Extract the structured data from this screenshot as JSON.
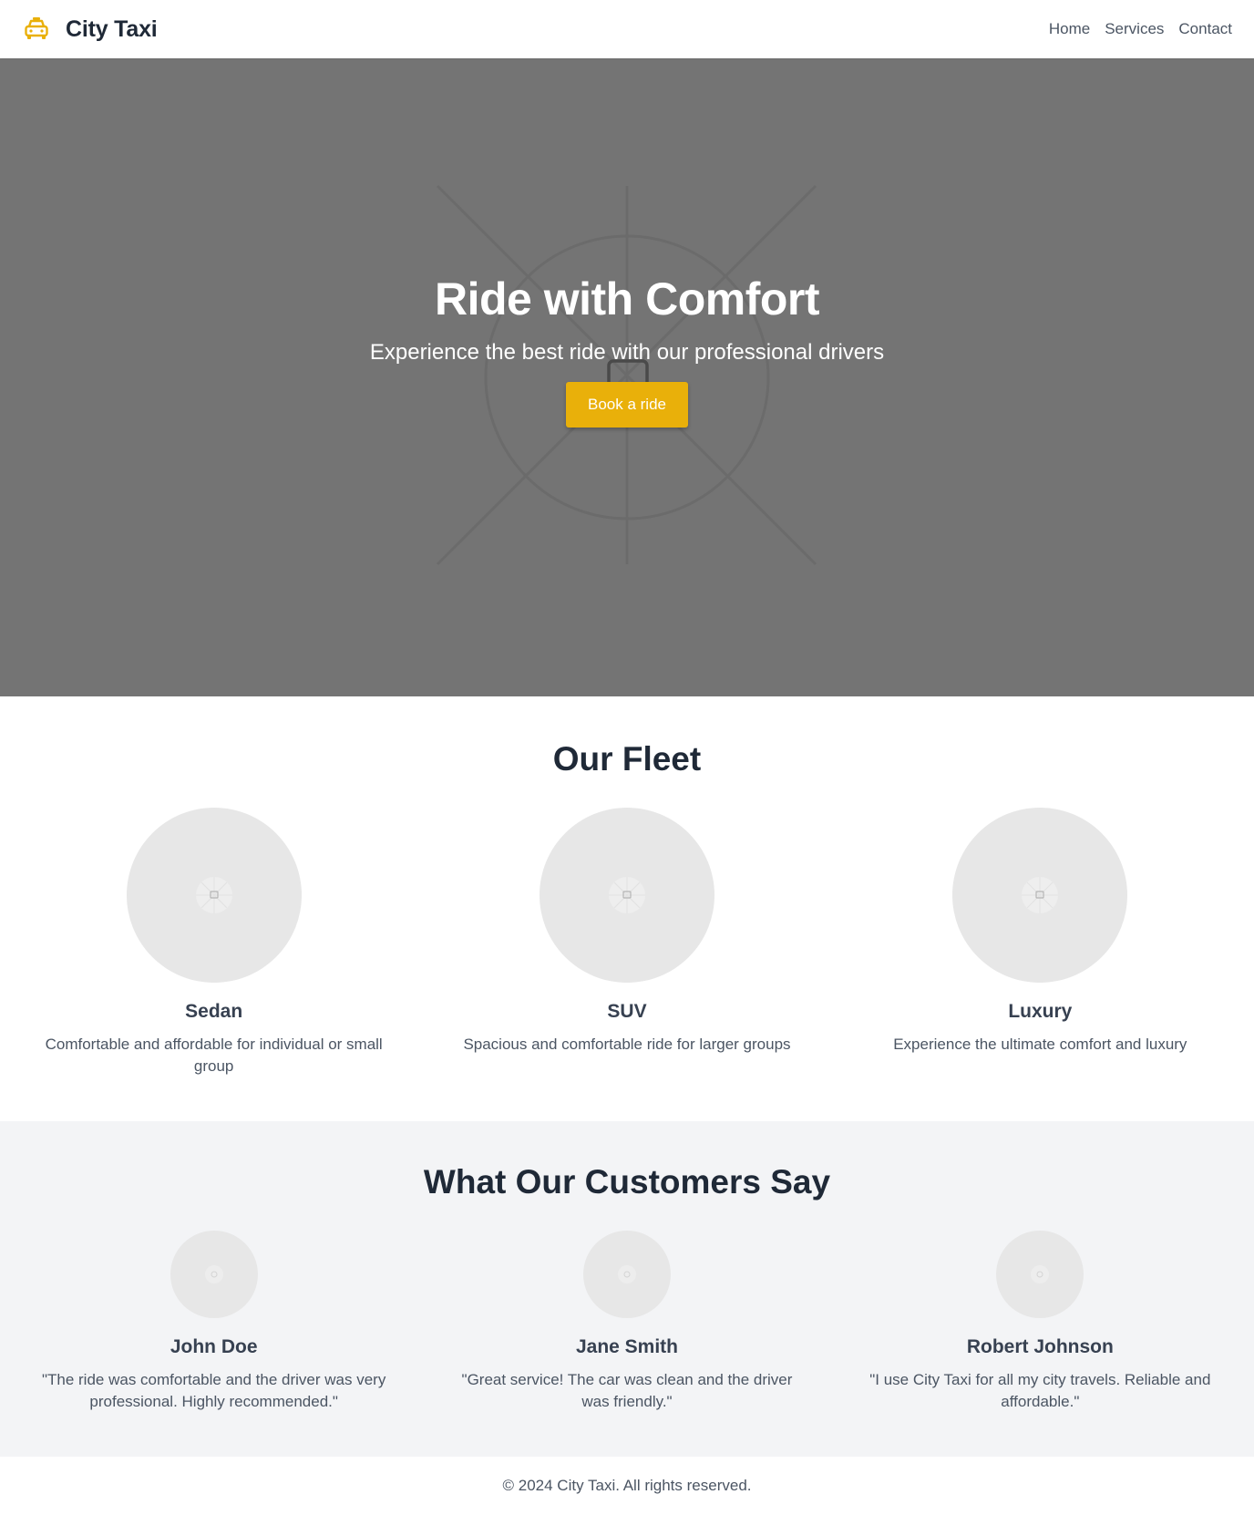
{
  "header": {
    "logo_icon": "taxi-icon",
    "brand": "City Taxi",
    "nav": [
      "Home",
      "Services",
      "Contact"
    ]
  },
  "hero": {
    "title": "Ride with Comfort",
    "subtitle": "Experience the best ride with our professional drivers",
    "cta": "Book a ride",
    "image_icon": "broken-image-icon"
  },
  "fleet": {
    "title": "Our Fleet",
    "items": [
      {
        "name": "Sedan",
        "description": "Comfortable and affordable for individual or small group",
        "image_icon": "image-placeholder-icon"
      },
      {
        "name": "SUV",
        "description": "Spacious and comfortable ride for larger groups",
        "image_icon": "image-placeholder-icon"
      },
      {
        "name": "Luxury",
        "description": "Experience the ultimate comfort and luxury",
        "image_icon": "image-placeholder-icon"
      }
    ]
  },
  "testimonials": {
    "title": "What Our Customers Say",
    "items": [
      {
        "name": "John Doe",
        "quote": "\"The ride was comfortable and the driver was very professional. Highly recommended.\"",
        "avatar_icon": "avatar-placeholder-icon"
      },
      {
        "name": "Jane Smith",
        "quote": "\"Great service! The car was clean and the driver was friendly.\"",
        "avatar_icon": "avatar-placeholder-icon"
      },
      {
        "name": "Robert Johnson",
        "quote": "\"I use City Taxi for all my city travels. Reliable and affordable.\"",
        "avatar_icon": "avatar-placeholder-icon"
      }
    ]
  },
  "footer": {
    "copyright": "© 2024 City Taxi. All rights reserved."
  },
  "colors": {
    "accent": "#e9b00a",
    "hero_bg": "#747474",
    "testimonials_bg": "#f3f4f6",
    "placeholder": "#e7e7e7",
    "heading": "#1f2937",
    "body_text": "#4b5563"
  }
}
